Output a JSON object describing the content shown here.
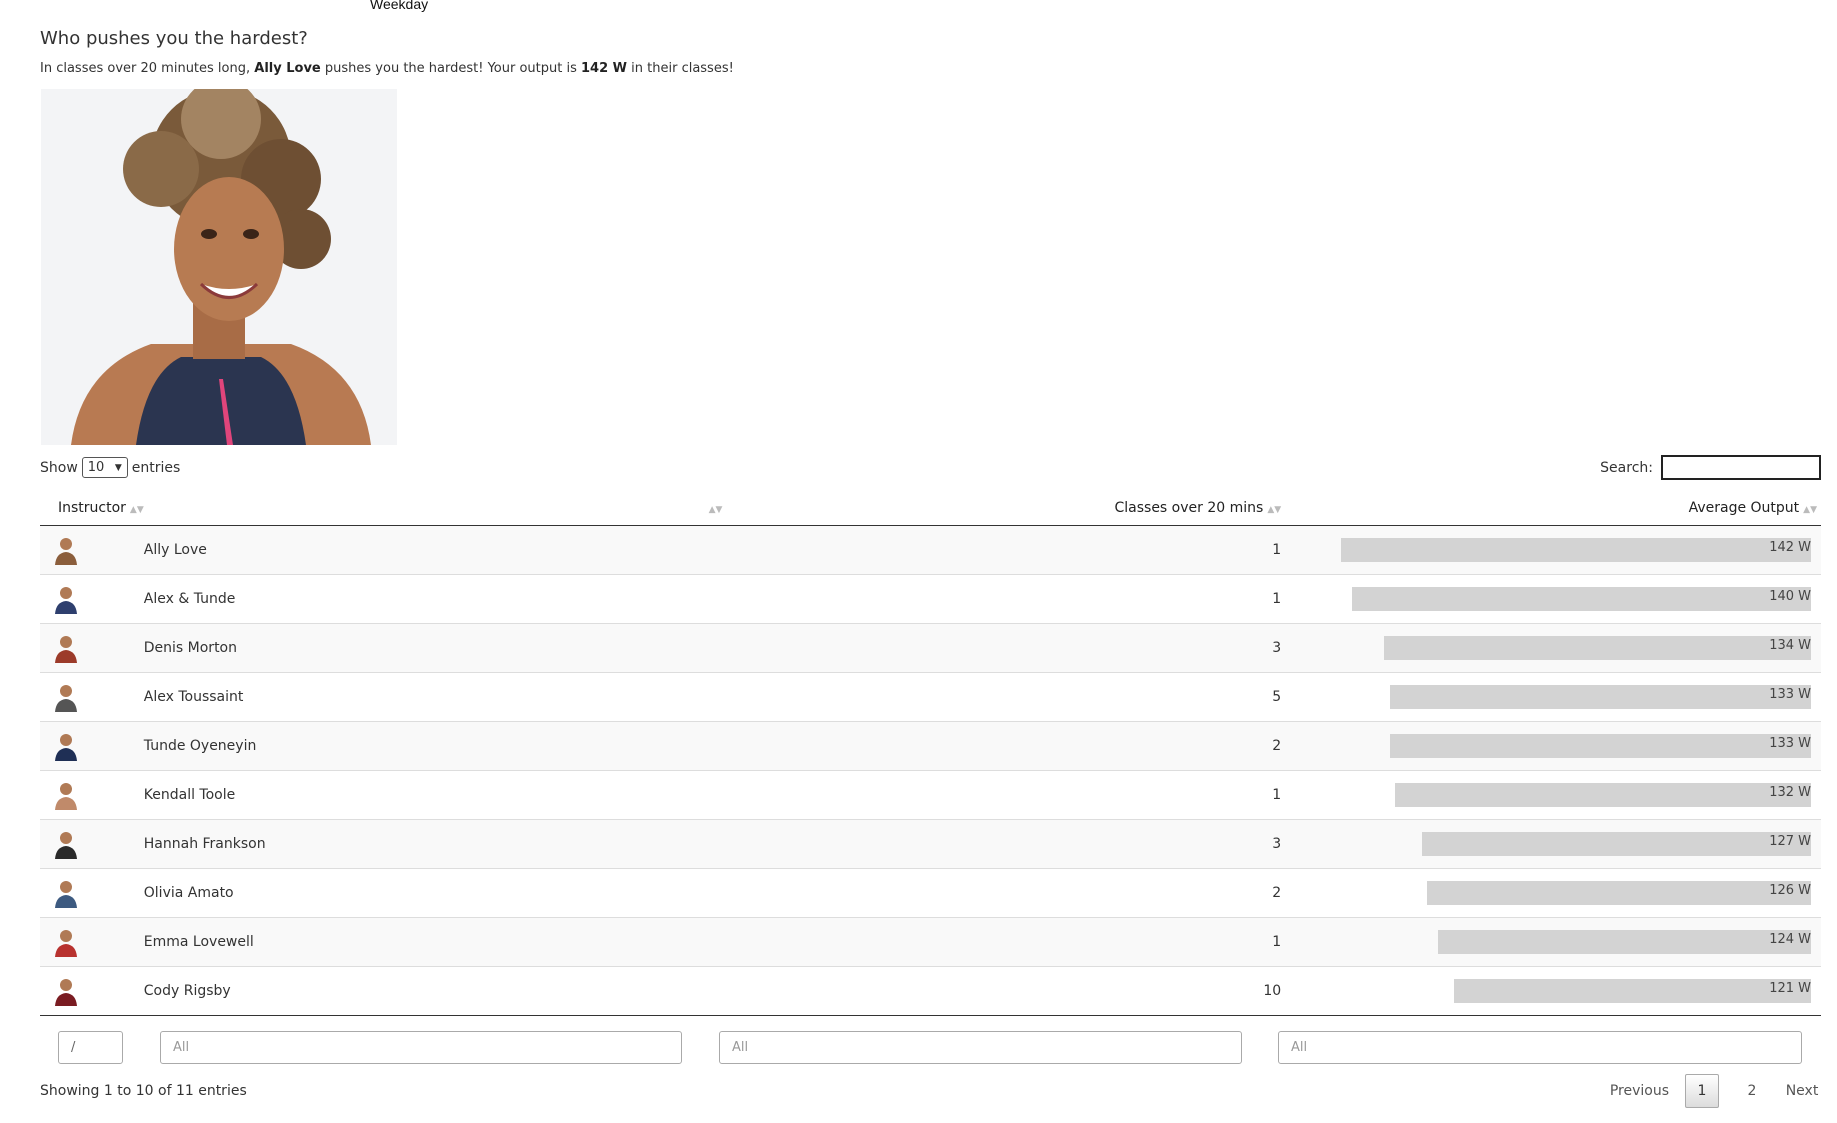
{
  "top_tab": "Weekday",
  "heading": "Who pushes you the hardest?",
  "summary": {
    "prefix": "In classes over 20 minutes long,",
    "instructor": "Ally Love",
    "middle": "pushes you the hardest! Your output is",
    "output": "142 W",
    "suffix": "in their classes!"
  },
  "controls": {
    "show_label": "Show",
    "page_size": "10",
    "entries_label": "entries",
    "search_label": "Search:"
  },
  "columns": [
    "Instructor",
    "Classes over 20 mins",
    "Average Output"
  ],
  "rows": [
    {
      "name": "Ally Love",
      "classes": "1",
      "output": "142 W",
      "value": 142
    },
    {
      "name": "Alex & Tunde",
      "classes": "1",
      "output": "140 W",
      "value": 140
    },
    {
      "name": "Denis Morton",
      "classes": "3",
      "output": "134 W",
      "value": 134
    },
    {
      "name": "Alex Toussaint",
      "classes": "5",
      "output": "133 W",
      "value": 133
    },
    {
      "name": "Tunde Oyeneyin",
      "classes": "2",
      "output": "133 W",
      "value": 133
    },
    {
      "name": "Kendall Toole",
      "classes": "1",
      "output": "132 W",
      "value": 132
    },
    {
      "name": "Hannah Frankson",
      "classes": "3",
      "output": "127 W",
      "value": 127
    },
    {
      "name": "Olivia Amato",
      "classes": "2",
      "output": "126 W",
      "value": 126
    },
    {
      "name": "Emma Lovewell",
      "classes": "1",
      "output": "124 W",
      "value": 124
    },
    {
      "name": "Cody Rigsby",
      "classes": "10",
      "output": "121 W",
      "value": 121
    }
  ],
  "filters": {
    "first": "/",
    "placeholder": "All"
  },
  "footer": {
    "info": "Showing 1 to 10 of 11 entries",
    "previous": "Previous",
    "pages": [
      "1",
      "2"
    ],
    "next": "Next"
  },
  "colors": {
    "bar": "#d3d3d3",
    "row_stripe": "#f9f9f9"
  }
}
